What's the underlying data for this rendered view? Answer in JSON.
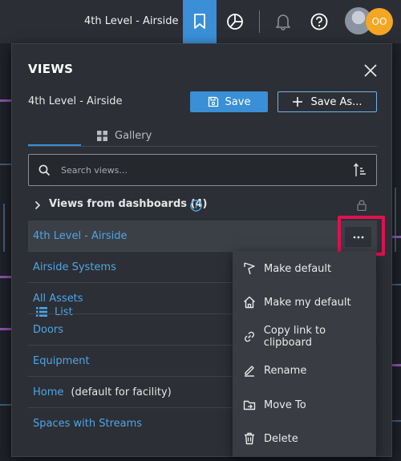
{
  "topbar": {
    "facility_name": "4th Level - Airside",
    "avatar_initials": "OO"
  },
  "panel": {
    "title": "VIEWS",
    "current_view": "4th Level - Airside",
    "save_label": "Save",
    "save_as_label": "Save As...",
    "tabs": [
      {
        "label": "List",
        "active": true
      },
      {
        "label": "Gallery",
        "active": false
      }
    ],
    "search": {
      "placeholder": "Search views..."
    },
    "group": {
      "label": "Views from dashboards (4)"
    },
    "views": [
      {
        "name": "4th Level - Airside",
        "suffix": ""
      },
      {
        "name": "Airside Systems",
        "suffix": ""
      },
      {
        "name": "All Assets",
        "suffix": ""
      },
      {
        "name": "Doors",
        "suffix": ""
      },
      {
        "name": "Equipment",
        "suffix": ""
      },
      {
        "name": "Home",
        "suffix": "(default for facility)"
      },
      {
        "name": "Spaces with Streams",
        "suffix": ""
      }
    ]
  },
  "context_menu": {
    "items": [
      {
        "label": "Make default",
        "icon": "flag-icon"
      },
      {
        "label": "Make my default",
        "icon": "home-icon"
      },
      {
        "label": "Copy link to clipboard",
        "icon": "link-icon"
      },
      {
        "label": "Rename",
        "icon": "pencil-icon"
      },
      {
        "label": "Move To",
        "icon": "move-to-icon"
      },
      {
        "label": "Delete",
        "icon": "trash-icon"
      }
    ]
  },
  "colors": {
    "accent": "#3a8fd6",
    "link": "#4da6e8",
    "highlight": "#e0114f",
    "avatar_badge": "#f5a623"
  }
}
